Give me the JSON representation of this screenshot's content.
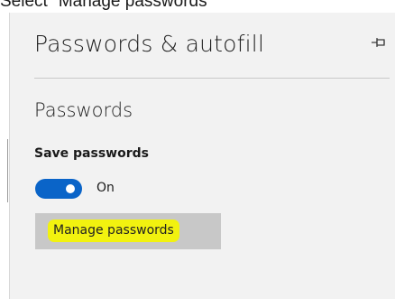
{
  "caption": {
    "text": "Select \"Manage passwords\""
  },
  "panel": {
    "title": "Passwords & autofill",
    "pin_icon": "pin-icon"
  },
  "passwords": {
    "section_title": "Passwords",
    "save_passwords": {
      "label": "Save passwords",
      "state": "On",
      "enabled": true
    },
    "manage_button": {
      "label": "Manage passwords",
      "highlighted": true
    }
  },
  "colors": {
    "toggle_on": "#0a64c8",
    "highlight": "#f2f20f",
    "button_bg": "#c8c8c8",
    "panel_bg": "#f2f2f2"
  }
}
